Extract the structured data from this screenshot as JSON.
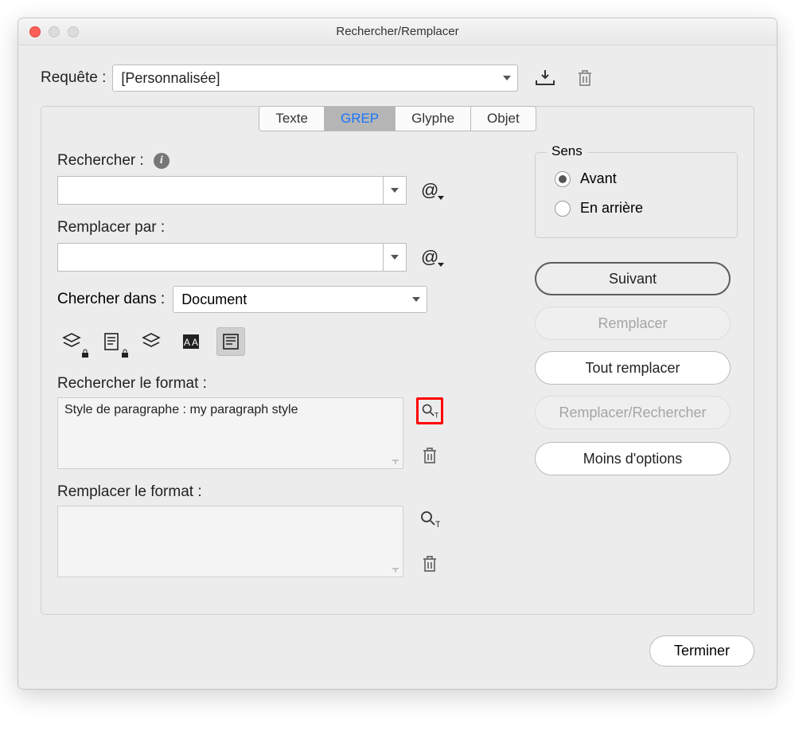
{
  "window": {
    "title": "Rechercher/Remplacer"
  },
  "query": {
    "label": "Requête :",
    "value": "[Personnalisée]"
  },
  "tabs": [
    "Texte",
    "GREP",
    "Glyphe",
    "Objet"
  ],
  "active_tab": "GREP",
  "search": {
    "label": "Rechercher :",
    "value": ""
  },
  "replace": {
    "label": "Remplacer par :",
    "value": ""
  },
  "search_in": {
    "label": "Chercher dans :",
    "value": "Document"
  },
  "search_format": {
    "label": "Rechercher le format :",
    "value": "Style de paragraphe : my paragraph style"
  },
  "replace_format": {
    "label": "Remplacer le format :",
    "value": ""
  },
  "sens": {
    "legend": "Sens",
    "forward": "Avant",
    "backward": "En arrière",
    "selected": "forward"
  },
  "buttons": {
    "next": "Suivant",
    "replace": "Remplacer",
    "replace_all": "Tout remplacer",
    "replace_find": "Remplacer/Rechercher",
    "less_options": "Moins d'options",
    "done": "Terminer"
  },
  "glyphs": {
    "at": "@"
  }
}
